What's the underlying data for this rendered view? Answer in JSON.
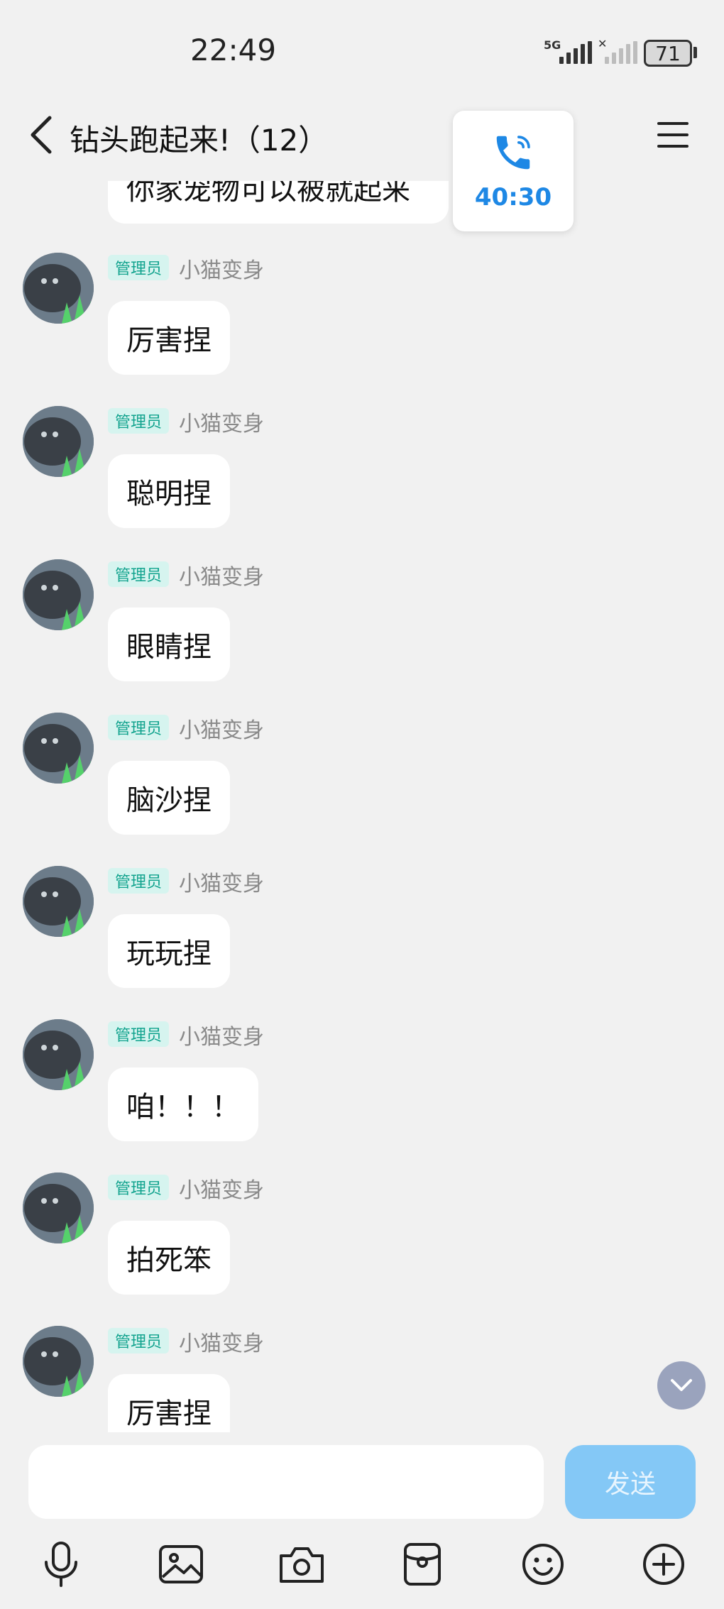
{
  "status_bar": {
    "time": "22:49",
    "network_label": "5G",
    "battery": "71"
  },
  "header": {
    "title": "钻头跑起来!（12）"
  },
  "call_card": {
    "duration": "40:30"
  },
  "top_message": {
    "text": "你家宠物可以被就起来"
  },
  "messages": [
    {
      "badge": "管理员",
      "sender": "小猫变身",
      "text": "厉害捏"
    },
    {
      "badge": "管理员",
      "sender": "小猫变身",
      "text": "聪明捏"
    },
    {
      "badge": "管理员",
      "sender": "小猫变身",
      "text": "眼睛捏"
    },
    {
      "badge": "管理员",
      "sender": "小猫变身",
      "text": "脑沙捏"
    },
    {
      "badge": "管理员",
      "sender": "小猫变身",
      "text": "玩玩捏"
    },
    {
      "badge": "管理员",
      "sender": "小猫变身",
      "text": "咱！！！"
    },
    {
      "badge": "管理员",
      "sender": "小猫变身",
      "text": "拍死笨"
    },
    {
      "badge": "管理员",
      "sender": "小猫变身",
      "text": "厉害捏"
    }
  ],
  "input": {
    "value": "",
    "send_label": "发送"
  },
  "toolbar": {
    "icons": [
      "microphone-icon",
      "image-icon",
      "camera-icon",
      "red-packet-icon",
      "emoji-icon",
      "plus-icon"
    ]
  },
  "colors": {
    "badge_bg": "#d6f4ef",
    "badge_text": "#12a38e",
    "send_button": "#84c8f6",
    "call_accent": "#1e88e5",
    "background": "#f1f1f1"
  }
}
